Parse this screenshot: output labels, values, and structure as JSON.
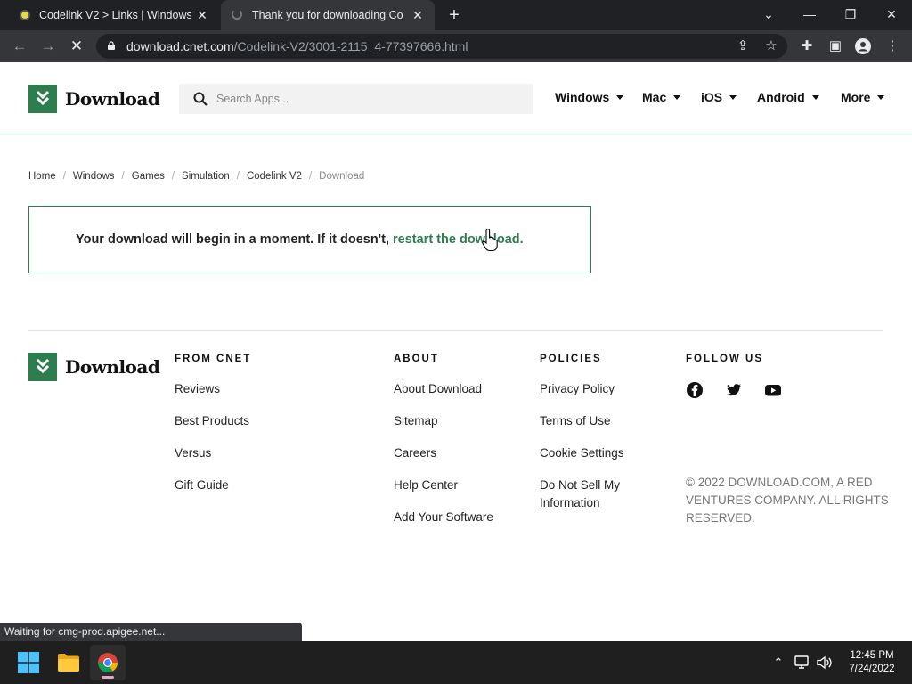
{
  "browser": {
    "tabs": [
      {
        "title": "Codelink V2 > Links | Windows",
        "active": false
      },
      {
        "title": "Thank you for downloading Codelink",
        "active": true
      }
    ],
    "url_host": "download.cnet.com",
    "url_path": "/Codelink-V2/3001-2115_4-77397666.html",
    "status_text": "Waiting for cmg-prod.apigee.net..."
  },
  "header": {
    "logo_text": "Download",
    "search_placeholder": "Search Apps...",
    "nav": [
      {
        "label": "Windows"
      },
      {
        "label": "Mac"
      },
      {
        "label": "iOS"
      },
      {
        "label": "Android"
      },
      {
        "label": "More"
      }
    ]
  },
  "breadcrumb": [
    "Home",
    "Windows",
    "Games",
    "Simulation",
    "Codelink V2",
    "Download"
  ],
  "notice": {
    "message": "Your download will begin in a moment. If it doesn't, ",
    "link_text": "restart the download."
  },
  "footer": {
    "logo_text": "Download",
    "columns": [
      {
        "heading": "FROM CNET",
        "links": [
          "Reviews",
          "Best Products",
          "Versus",
          "Gift Guide"
        ]
      },
      {
        "heading": "ABOUT",
        "links": [
          "About Download",
          "Sitemap",
          "Careers",
          "Help Center",
          "Add Your Software"
        ]
      },
      {
        "heading": "POLICIES",
        "links": [
          "Privacy Policy",
          "Terms of Use",
          "Cookie Settings",
          "Do Not Sell My Information"
        ]
      },
      {
        "heading": "FOLLOW US",
        "social": [
          "facebook-icon",
          "twitter-icon",
          "youtube-icon"
        ]
      }
    ],
    "copyright": "© 2022 DOWNLOAD.COM, A RED VENTURES COMPANY. ALL RIGHTS RESERVED."
  },
  "taskbar": {
    "time": "12:45 PM",
    "date": "7/24/2022"
  },
  "colors": {
    "brand_green": "#2e7d4f",
    "chrome_dark": "#202124",
    "chrome_toolbar": "#35363a"
  }
}
